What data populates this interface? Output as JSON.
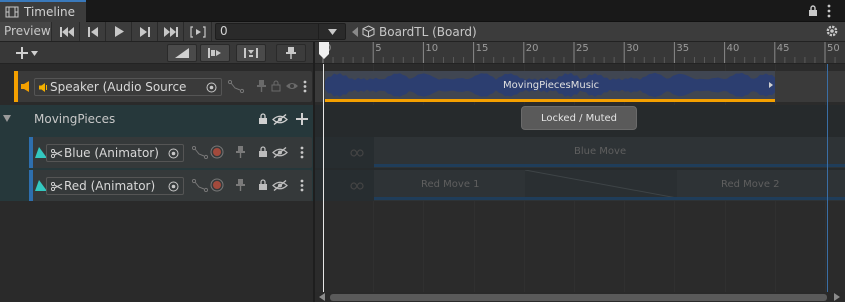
{
  "window": {
    "tab_title": "Timeline",
    "tab_icon": "film-icon"
  },
  "toolbar": {
    "preview_label": "Preview",
    "frame_value": "0",
    "asset_label": "BoardTL (Board)",
    "buttons": [
      "go-to-start-icon",
      "previous-frame-icon",
      "play-icon",
      "next-frame-icon",
      "go-to-end-icon",
      "play-range-icon"
    ]
  },
  "ruler": {
    "ticks": [
      "0",
      "5",
      "10",
      "15",
      "20",
      "25",
      "30",
      "35",
      "40",
      "45",
      "50"
    ]
  },
  "tracks": {
    "speaker": {
      "name": "Speaker (Audio Source",
      "clip": "MovingPiecesMusic",
      "accent": "#f4a000"
    },
    "group": {
      "name": "MovingPieces",
      "overlay": "Locked / Muted"
    },
    "blue": {
      "name": "Blue (Animator)",
      "clip": "Blue Move",
      "accent": "#33b5c8"
    },
    "red": {
      "name": "Red (Animator)",
      "clips": [
        "Red Move 1",
        "Red Move 2"
      ],
      "accent": "#33b5c8"
    }
  }
}
